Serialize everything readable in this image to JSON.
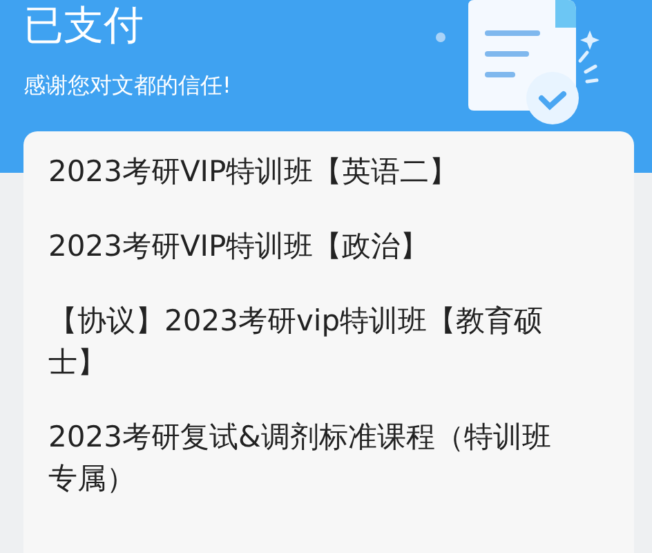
{
  "header": {
    "title": "已支付",
    "subtitle": "感谢您对文都的信任!"
  },
  "courses": [
    {
      "name": "2023考研VIP特训班【英语二】"
    },
    {
      "name": "2023考研VIP特训班【政治】"
    },
    {
      "name": "【协议】2023考研vip特训班【教育硕士】"
    },
    {
      "name": "2023考研复试&调剂标准课程（特训班专属）"
    }
  ]
}
